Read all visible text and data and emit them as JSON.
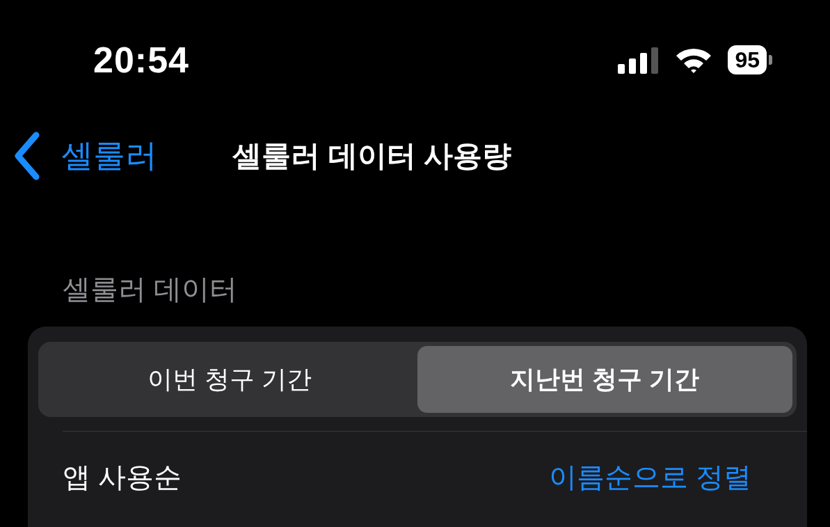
{
  "status_bar": {
    "time": "20:54",
    "battery": "95"
  },
  "nav": {
    "back": "셀룰러",
    "title": "셀룰러 데이터 사용량"
  },
  "section_header": "셀룰러 데이터",
  "segments": [
    {
      "label": "이번 청구 기간",
      "selected": false
    },
    {
      "label": "지난번 청구 기간",
      "selected": true
    }
  ],
  "row": {
    "label": "앱 사용순",
    "action": "이름순으로 정렬"
  }
}
